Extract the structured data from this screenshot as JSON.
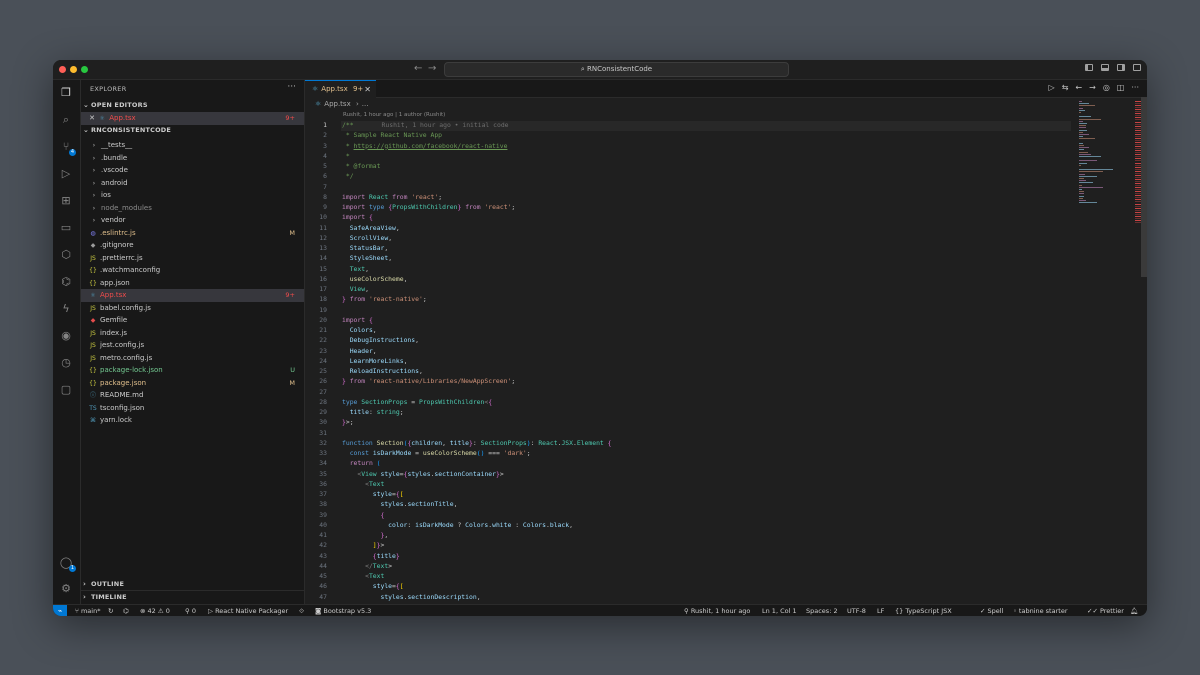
{
  "window": {
    "title": "RNConsistentCode",
    "colors": {
      "accent": "#0078d4",
      "modified": "#e2c08d",
      "untracked": "#73c991",
      "error": "#f14c4c"
    }
  },
  "activity_bar": {
    "icons": [
      "explorer-icon",
      "search-icon",
      "source-control-icon",
      "run-debug-icon",
      "extensions-icon",
      "remote-explorer-icon",
      "testing-icon",
      "gitlens-icon",
      "lightning-icon",
      "github-icon",
      "timeline-icon",
      "chat-icon",
      "account-icon",
      "settings-icon"
    ],
    "source_control_badge": "4",
    "settings_badge": "1"
  },
  "sidebar": {
    "title": "EXPLORER",
    "more": "···",
    "open_editors_label": "OPEN EDITORS",
    "open_editors": [
      {
        "name": "App.tsx",
        "status": "9+"
      }
    ],
    "project_label": "RNCONSISTENTCODE",
    "tree": [
      {
        "name": "__tests__",
        "kind": "folder",
        "status": ""
      },
      {
        "name": ".bundle",
        "kind": "folder",
        "status": ""
      },
      {
        "name": ".vscode",
        "kind": "folder",
        "status": ""
      },
      {
        "name": "android",
        "kind": "folder",
        "status": ""
      },
      {
        "name": "ios",
        "kind": "folder",
        "status": ""
      },
      {
        "name": "node_modules",
        "kind": "folder-dim",
        "status": ""
      },
      {
        "name": "vendor",
        "kind": "folder",
        "status": ""
      },
      {
        "name": ".eslintrc.js",
        "kind": "eslint",
        "status": "M"
      },
      {
        "name": ".gitignore",
        "kind": "git",
        "status": ""
      },
      {
        "name": ".prettierrc.js",
        "kind": "js",
        "status": ""
      },
      {
        "name": ".watchmanconfig",
        "kind": "json",
        "status": ""
      },
      {
        "name": "app.json",
        "kind": "json",
        "status": ""
      },
      {
        "name": "App.tsx",
        "kind": "react",
        "status": "9+"
      },
      {
        "name": "babel.config.js",
        "kind": "js",
        "status": ""
      },
      {
        "name": "Gemfile",
        "kind": "ruby",
        "status": ""
      },
      {
        "name": "index.js",
        "kind": "js",
        "status": ""
      },
      {
        "name": "jest.config.js",
        "kind": "js",
        "status": ""
      },
      {
        "name": "metro.config.js",
        "kind": "js",
        "status": ""
      },
      {
        "name": "package-lock.json",
        "kind": "json",
        "status": "U"
      },
      {
        "name": "package.json",
        "kind": "json",
        "status": "M"
      },
      {
        "name": "README.md",
        "kind": "info",
        "status": ""
      },
      {
        "name": "tsconfig.json",
        "kind": "ts",
        "status": ""
      },
      {
        "name": "yarn.lock",
        "kind": "yarn",
        "status": ""
      }
    ],
    "outline_label": "OUTLINE",
    "timeline_label": "TIMELINE"
  },
  "editor": {
    "tab": {
      "name": "App.tsx",
      "badge": "9+"
    },
    "breadcrumb": [
      "App.tsx",
      "..."
    ],
    "blame_header": "Rushit, 1 hour ago | 1 author (Rushit)",
    "line_blame": "Rushit, 1 hour ago • initial code",
    "current_line": 1,
    "line_numbers": [
      "1",
      "2",
      "3",
      "4",
      "5",
      "6",
      "7",
      "8",
      "9",
      "10",
      "11",
      "12",
      "13",
      "14",
      "15",
      "16",
      "17",
      "18",
      "19",
      "20",
      "21",
      "22",
      "23",
      "24",
      "25",
      "26",
      "27",
      "28",
      "29",
      "30",
      "31",
      "32",
      "33",
      "34",
      "35",
      "36",
      "37",
      "38",
      "39",
      "40",
      "41",
      "42",
      "43",
      "44",
      "45",
      "46",
      "47"
    ],
    "code_lines": [
      "/**",
      " * Sample React Native App",
      " * https://github.com/facebook/react-native",
      " *",
      " * @format",
      " */",
      "",
      "import React from 'react';",
      "import type {PropsWithChildren} from 'react';",
      "import {",
      "  SafeAreaView,",
      "  ScrollView,",
      "  StatusBar,",
      "  StyleSheet,",
      "  Text,",
      "  useColorScheme,",
      "  View,",
      "} from 'react-native';",
      "",
      "import {",
      "  Colors,",
      "  DebugInstructions,",
      "  Header,",
      "  LearnMoreLinks,",
      "  ReloadInstructions,",
      "} from 'react-native/Libraries/NewAppScreen';",
      "",
      "type SectionProps = PropsWithChildren<{",
      "  title: string;",
      "}>;",
      "",
      "function Section({children, title}: SectionProps): React.JSX.Element {",
      "  const isDarkMode = useColorScheme() === 'dark';",
      "  return (",
      "    <View style={styles.sectionContainer}>",
      "      <Text",
      "        style={[",
      "          styles.sectionTitle,",
      "          {",
      "            color: isDarkMode ? Colors.white : Colors.black,",
      "          },",
      "        ]}>",
      "        {title}",
      "      </Text>",
      "      <Text",
      "        style={[",
      "          styles.sectionDescription,"
    ]
  },
  "statusbar": {
    "remote": "⌁",
    "branch": "main*",
    "sync": "↻",
    "errors": "42",
    "warnings": "0",
    "ports": "0",
    "task": "React Native Packager",
    "bootstrap": "Bootstrap v5.3",
    "blame": "Rushit, 1 hour ago",
    "position": "Ln 1, Col 1",
    "spaces": "Spaces: 2",
    "encoding": "UTF-8",
    "eol": "LF",
    "language": "TypeScript JSX",
    "spell": "Spell",
    "tabnine": "tabnine starter",
    "prettier": "Prettier"
  }
}
